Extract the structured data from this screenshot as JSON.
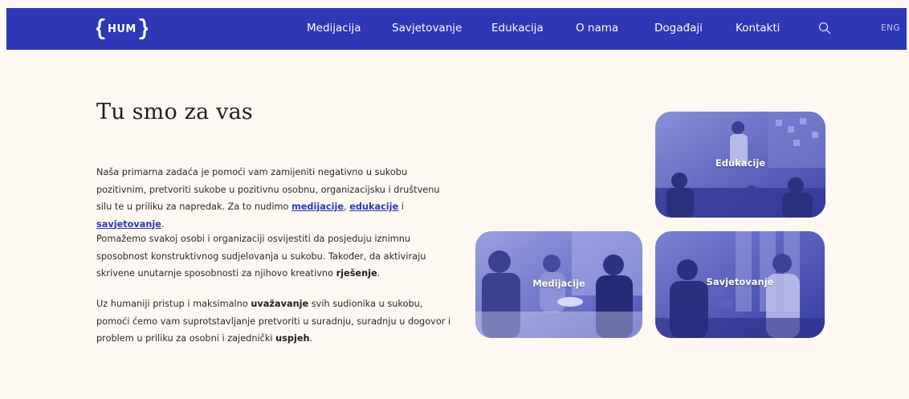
{
  "header": {
    "logo_text": "HUM",
    "nav": [
      {
        "label": "Medijacija"
      },
      {
        "label": "Savjetovanje"
      },
      {
        "label": "Edukacija"
      },
      {
        "label": "O nama"
      },
      {
        "label": "Događaji"
      },
      {
        "label": "Kontakti"
      }
    ],
    "search_icon": "search-icon",
    "lang_label": "ENG"
  },
  "main": {
    "heading": "Tu smo za vas",
    "p1": {
      "text_a": "Naša primarna zadaća je pomoći vam zamijeniti negativno u sukobu pozitivnim, pretvoriti sukobe u pozitivnu osobnu, organizacijsku i društvenu silu te u priliku za napredak. Za to nudimo ",
      "link1": "medijacije",
      "sep1": ", ",
      "link2": "edukacije",
      "sep2": " i ",
      "link3": "savjetovanje",
      "end": "."
    },
    "p2": {
      "text_a": "Pomažemo svakoj osobi i organizaciji osvijestiti da posjeduju iznimnu sposobnost konstruktivnog sudjelovanja u sukobu. Također, da aktiviraju skrivene unutarnje sposobnosti za njihovo kreativno ",
      "bold": "rješenje",
      "end": "."
    },
    "p3": {
      "text_a": "Uz humaniji pristup i maksimalno ",
      "bold1": "uvažavanje",
      "text_b": " svih sudionika u sukobu, pomoći ćemo vam suprotstavljanje pretvoriti u suradnju, suradnju u dogovor i problem u priliku za osobni i zajednički ",
      "bold2": "uspjeh",
      "end": "."
    }
  },
  "cards": {
    "edukacije": "Edukacije",
    "medijacije": "Medijacije",
    "savjetovanje": "Savjetovanje"
  },
  "colors": {
    "brand": "#2e37b5",
    "background": "#fdf8f2",
    "card_tint": "#5c63c8"
  }
}
